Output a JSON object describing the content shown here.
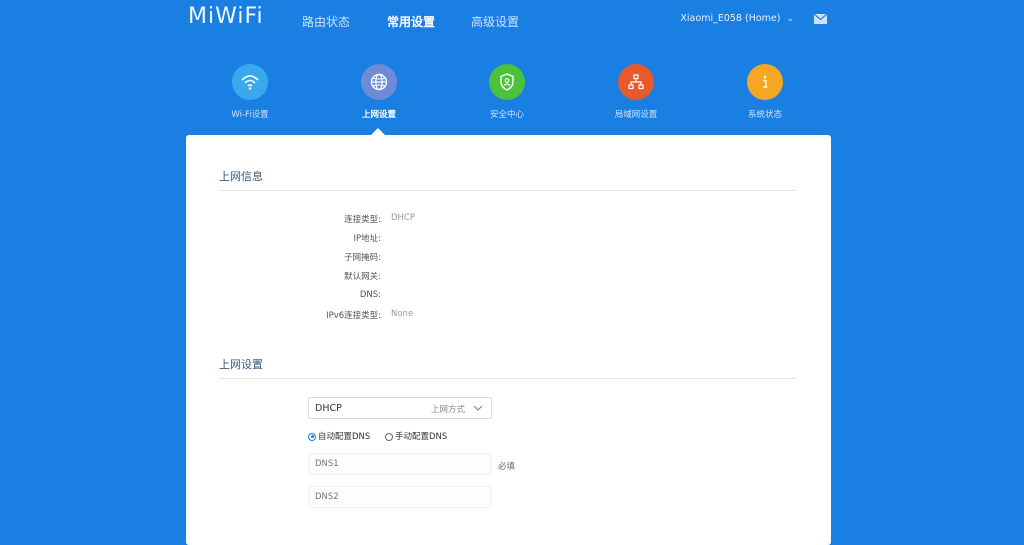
{
  "header": {
    "logo": "MiWiFi",
    "nav": [
      "路由状态",
      "常用设置",
      "高级设置"
    ],
    "active_nav": 1,
    "device_name": "Xiaomi_E058 (Home)"
  },
  "categories": [
    {
      "label": "Wi-Fi设置",
      "color": "#3aa8ec",
      "icon": "wifi-icon"
    },
    {
      "label": "上网设置",
      "color": "#6f8bd8",
      "icon": "globe-icon"
    },
    {
      "label": "安全中心",
      "color": "#4cc13b",
      "icon": "shield-icon"
    },
    {
      "label": "局域网设置",
      "color": "#e65a2c",
      "icon": "network-icon"
    },
    {
      "label": "系统状态",
      "color": "#f5a623",
      "icon": "info-icon"
    }
  ],
  "active_category": 1,
  "info_section": {
    "title": "上网信息",
    "rows": [
      {
        "label": "连接类型:",
        "value": "DHCP"
      },
      {
        "label": "IP地址:",
        "value": ""
      },
      {
        "label": "子网掩码:",
        "value": ""
      },
      {
        "label": "默认网关:",
        "value": ""
      },
      {
        "label": "DNS:",
        "value": ""
      },
      {
        "label": "IPv6连接类型:",
        "value": "None"
      }
    ]
  },
  "settings_section": {
    "title": "上网设置",
    "mode_value": "DHCP",
    "mode_hint": "上网方式",
    "radios": [
      {
        "label": "自动配置DNS",
        "checked": true
      },
      {
        "label": "手动配置DNS",
        "checked": false
      }
    ],
    "dns1_placeholder": "DNS1",
    "dns2_placeholder": "DNS2",
    "required_label": "必填"
  }
}
